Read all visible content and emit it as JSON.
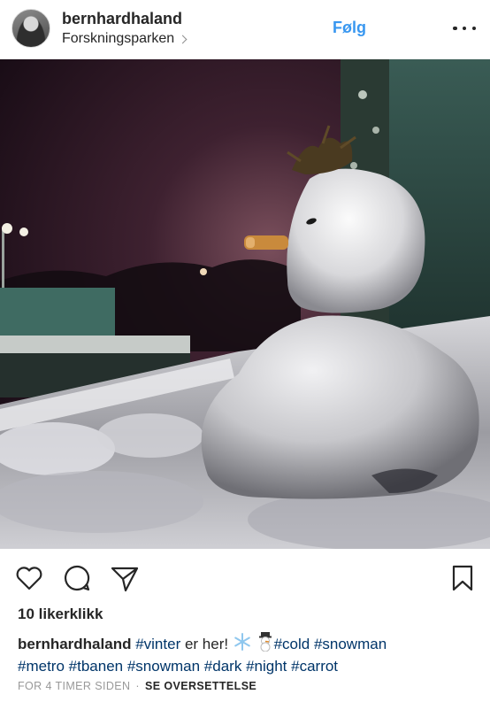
{
  "post": {
    "username": "bernhardhaland",
    "location": "Forskningsparken",
    "follow_label": "Følg",
    "likes_text": "10 likerklikk",
    "caption": {
      "username": "bernhardhaland",
      "part1": "#vinter",
      "part2": " er her! ",
      "part3": "#cold",
      "part4": "#snowman",
      "line2": [
        "#metro",
        "#tbanen",
        "#snowman",
        "#dark",
        "#night",
        "#carrot"
      ]
    },
    "timestamp": "FOR 4 TIMER SIDEN",
    "separator": "·",
    "translate_label": "SE OVERSETTELSE"
  },
  "icons": {
    "avatar": "profile-avatar",
    "more": "more-options-icon",
    "like": "heart-icon",
    "comment": "comment-icon",
    "share": "paper-plane-icon",
    "save": "bookmark-icon",
    "snowflake": "snowflake-emoji",
    "snowman": "snowman-emoji"
  },
  "colors": {
    "link_blue": "#3897f0",
    "hashtag": "#003569",
    "text": "#262626",
    "muted": "#999999"
  }
}
